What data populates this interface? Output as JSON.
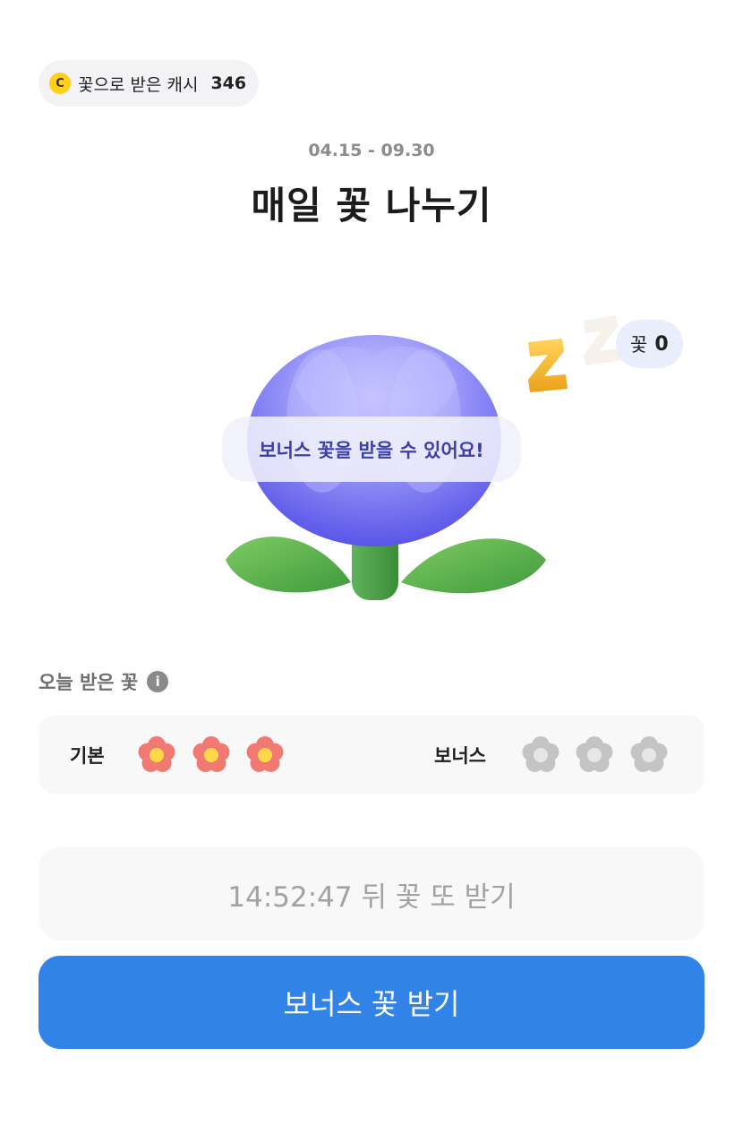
{
  "cash": {
    "icon": "coin-icon",
    "coin_letter": "C",
    "label": "꽃으로 받은 캐시",
    "amount": "346"
  },
  "event": {
    "period": "04.15 - 09.30",
    "title": "매일 꽃 나누기"
  },
  "flower_count": {
    "label": "꽃",
    "value": "0"
  },
  "bonus_hint": "보너스 꽃을 받을 수 있어요!",
  "today": {
    "label": "오늘 받은 꽃",
    "info_glyph": "i",
    "basic_label": "기본",
    "bonus_label": "보너스",
    "basic_received": 3,
    "basic_total": 3,
    "bonus_received": 0,
    "bonus_total": 3
  },
  "timer_text": "14:52:47 뒤 꽃 또 받기",
  "bonus_button_label": "보너스 꽃 받기",
  "colors": {
    "accent": "#3183e7",
    "flower_active": "#f07a72",
    "flower_center": "#ffd84a",
    "flower_inactive": "#c4c4c4"
  }
}
